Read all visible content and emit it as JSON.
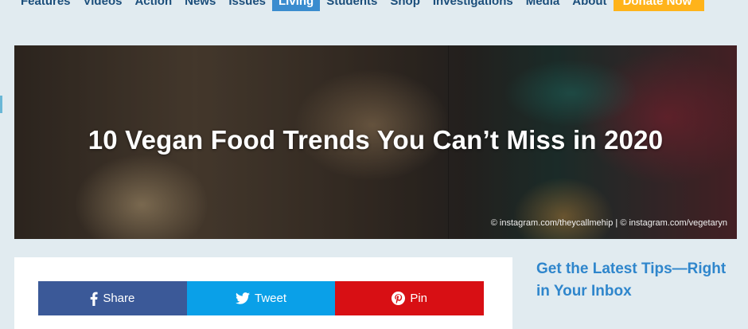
{
  "nav": {
    "items": [
      {
        "label": "Features"
      },
      {
        "label": "Videos"
      },
      {
        "label": "Action"
      },
      {
        "label": "News"
      },
      {
        "label": "Issues"
      },
      {
        "label": "Living",
        "active": true
      },
      {
        "label": "Students"
      },
      {
        "label": "Shop"
      },
      {
        "label": "Investigations"
      },
      {
        "label": "Media"
      },
      {
        "label": "About"
      }
    ],
    "donate_label": "Donate Now"
  },
  "hero": {
    "title": "10 Vegan Food Trends You Can’t Miss in 2020",
    "credit": "© instagram.com/theycallmehip | © instagram.com/vegetaryn"
  },
  "share": {
    "facebook_label": "Share",
    "twitter_label": "Tweet",
    "pinterest_label": "Pin",
    "facebook_icon": "facebook-icon",
    "twitter_icon": "twitter-icon",
    "pinterest_icon": "pinterest-icon"
  },
  "sidebar": {
    "heading": "Get the Latest Tips—Right in Your Inbox"
  },
  "colors": {
    "page_bg": "#e1ebf0",
    "nav_text": "#1b4e7b",
    "nav_active": "#3a8ccf",
    "donate": "#ffb31a",
    "facebook": "#3b5998",
    "twitter": "#0aa0e8",
    "pinterest": "#d80f14",
    "sidebar_heading": "#2f86cc"
  }
}
